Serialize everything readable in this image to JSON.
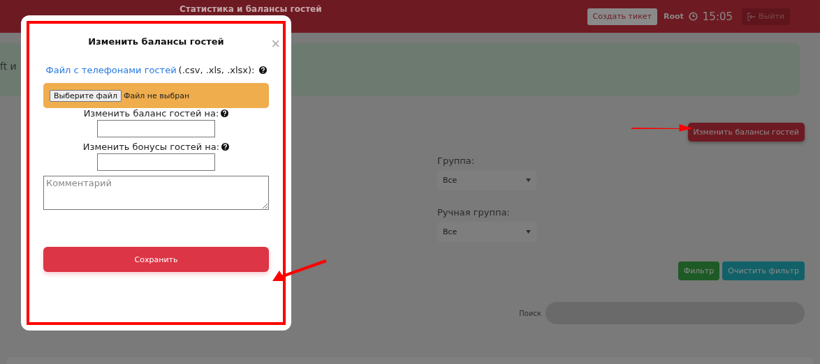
{
  "header": {
    "title": "Статистика и балансы гостей",
    "ticket_button": "Создать тикет",
    "user": "Root",
    "time": "15:05",
    "logout_button": "Выйти"
  },
  "alert": {
    "text": "ft и"
  },
  "page": {
    "change_balances_button": "Изменить балансы гостей",
    "filters": [
      {
        "label": "Группа:",
        "value": "Все"
      },
      {
        "label": "Ручная группа:",
        "value": "Все"
      }
    ],
    "filter_button": "Фильтр",
    "clear_button": "Очистить фильтр",
    "search_label": "Поиск"
  },
  "modal": {
    "title": "Изменить балансы гостей",
    "close": "×",
    "file_link": "Файл с телефонами гостей",
    "file_formats": "(.csv, .xls, .xlsx):",
    "file_button": "Выберите файл",
    "file_status": "Файл не выбран",
    "fields": [
      {
        "label": "Изменить баланс гостей на:"
      },
      {
        "label": "Изменить бонусы гостей на:"
      }
    ],
    "comment_placeholder": "Комментарий",
    "save_button": "Сохранить"
  }
}
